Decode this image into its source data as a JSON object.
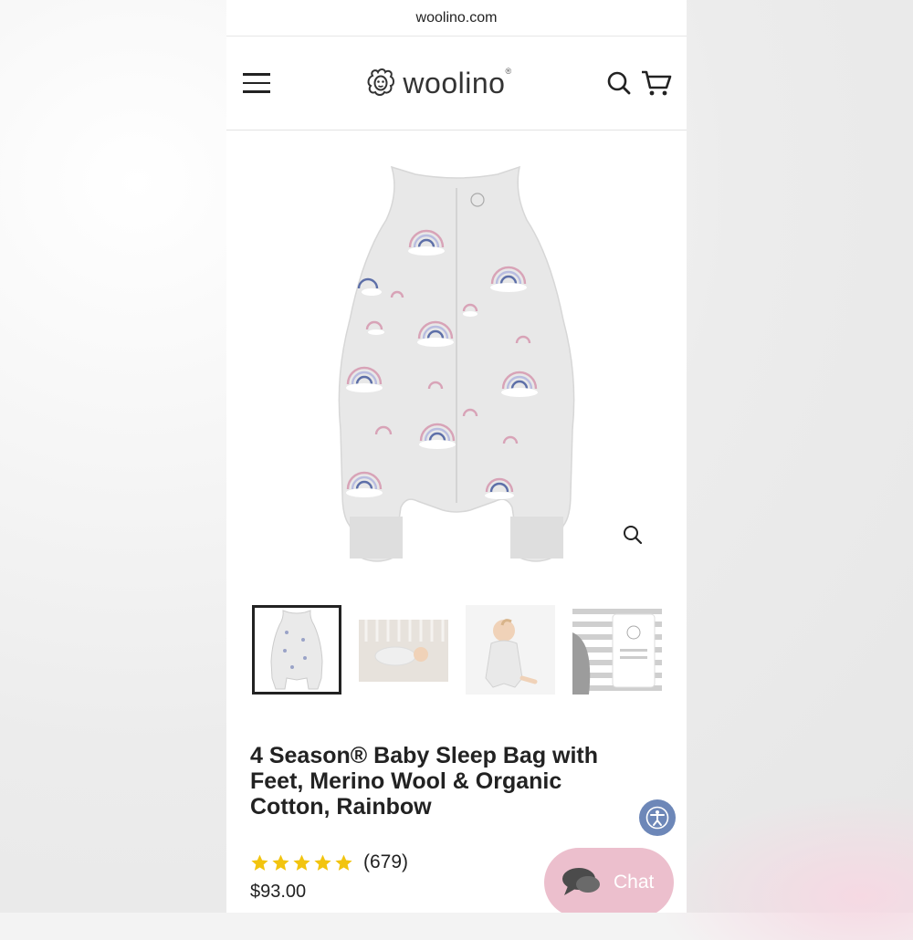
{
  "browser": {
    "url": "woolino.com"
  },
  "header": {
    "logo_text": "woolino",
    "logo_reg": "®"
  },
  "product": {
    "title": "4 Season® Baby Sleep Bag with Feet, Merino Wool & Organic Cotton, Rainbow",
    "rating": 5,
    "review_count": "(679)",
    "price": "$93.00"
  },
  "thumbnails": [
    {
      "name": "sleep-bag-front",
      "active": true
    },
    {
      "name": "baby-in-crib",
      "active": false
    },
    {
      "name": "baby-wearing-bag",
      "active": false
    },
    {
      "name": "fabric-detail",
      "active": false
    }
  ],
  "chat": {
    "label": "Chat"
  },
  "colors": {
    "star": "#f2c40f",
    "chat_bg": "#ecbfcd",
    "accessibility_bg": "#6d87b8",
    "text": "#222222"
  }
}
